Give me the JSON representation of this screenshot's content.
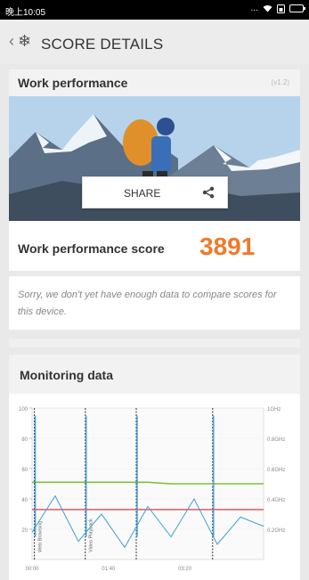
{
  "status_bar": {
    "time": "晚上10:05",
    "dots": "..."
  },
  "app_bar": {
    "title": "SCORE DETAILS"
  },
  "work_card": {
    "title": "Work performance",
    "version": "(v1.2)",
    "share_label": "SHARE",
    "score_label": "Work performance score",
    "score_value": "3891"
  },
  "notice": {
    "text": "Sorry, we don't yet have enough data to compare scores for this device."
  },
  "monitoring": {
    "title": "Monitoring data"
  },
  "chart_data": {
    "type": "line",
    "xlabel": "",
    "ylabel": "",
    "x_ticks": [
      "00:00",
      "01:40",
      "03:20"
    ],
    "y_left_ticks": [
      "100",
      "80",
      "60",
      "40",
      "20"
    ],
    "y_right_ticks": [
      "1GHz",
      "0.8GHz",
      "0.6GHz",
      "0.4GHz",
      "0.2GHz"
    ],
    "ylim_left": [
      0,
      100
    ],
    "test_labels": [
      "Web Browsing",
      "Video Playback"
    ],
    "colors": {
      "battery": "#7cc142",
      "temperature": "#e04a4a",
      "cpu": "#3f9fd8",
      "marker": "#333333"
    },
    "x": [
      0,
      10,
      20,
      30,
      40,
      50,
      60,
      70,
      80,
      90,
      100
    ],
    "series": [
      {
        "values": [
          51,
          51,
          51,
          51,
          51,
          51,
          50,
          50,
          50,
          50,
          50
        ]
      },
      {
        "values": [
          33,
          33,
          33,
          33,
          33,
          33,
          33,
          33,
          33,
          33,
          33
        ]
      },
      {
        "values": [
          18,
          42,
          12,
          30,
          8,
          35,
          15,
          40,
          10,
          28,
          22
        ]
      }
    ]
  }
}
